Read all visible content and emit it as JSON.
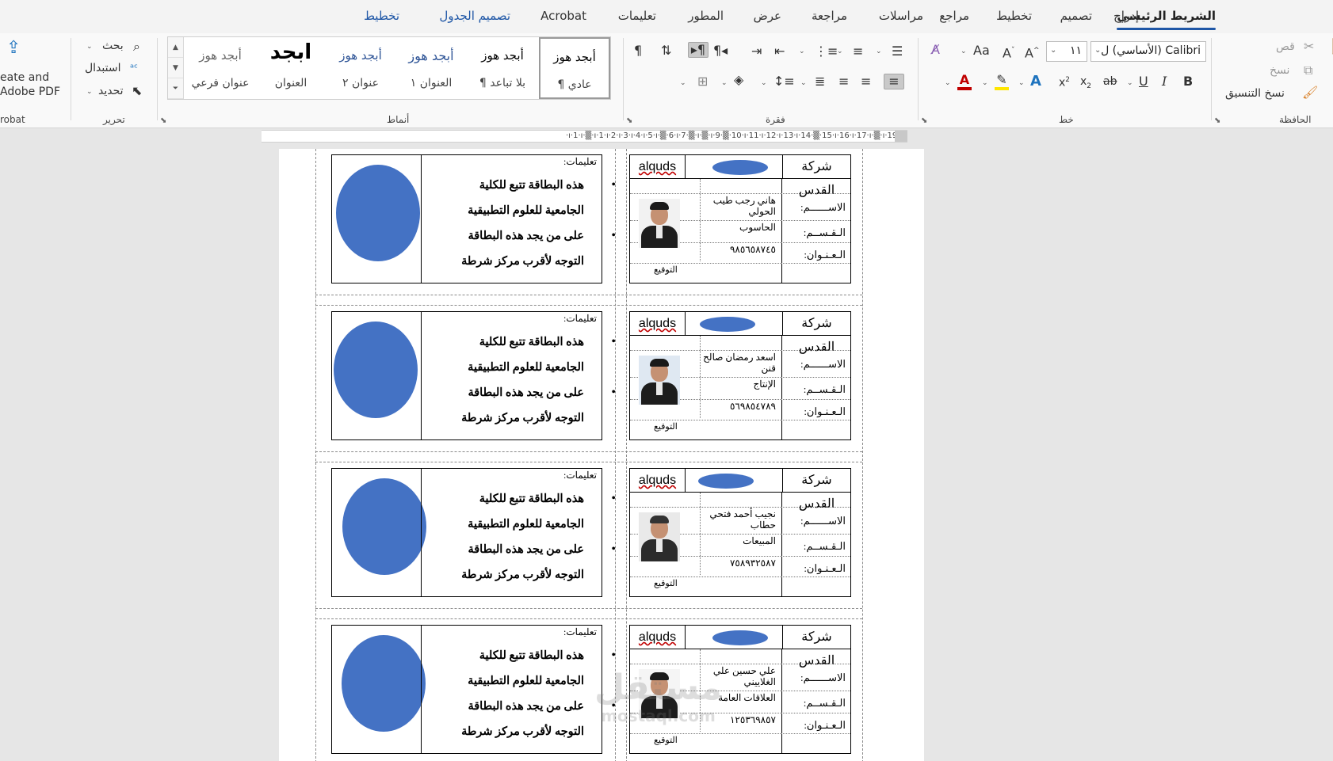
{
  "tabs": [
    {
      "label": "الشريط الرئيسي",
      "active": true
    },
    {
      "label": "إدراج"
    },
    {
      "label": "تصميم"
    },
    {
      "label": "تخطيط"
    },
    {
      "label": "مراجع"
    },
    {
      "label": "مراسلات"
    },
    {
      "label": "مراجعة"
    },
    {
      "label": "عرض"
    },
    {
      "label": "المطور"
    },
    {
      "label": "تعليمات"
    },
    {
      "label": "Acrobat"
    },
    {
      "label": "تصميم الجدول",
      "contextual": true
    },
    {
      "label": "تخطيط",
      "contextual": true
    }
  ],
  "ribbon": {
    "clipboard": {
      "cut": "قص",
      "copy": "نسخ",
      "format_painter": "نسخ التنسيق",
      "label": "الحافظة"
    },
    "font": {
      "name": "Calibri (الأساسي) ل",
      "size": "١١",
      "label": "خط"
    },
    "paragraph": {
      "label": "فقرة"
    },
    "styles": {
      "label": "أنماط",
      "items": [
        {
          "sample": "أبجد هوز",
          "name": "¶ عادي",
          "selected": true
        },
        {
          "sample": "أبجد هوز",
          "name": "¶ بلا تباعد"
        },
        {
          "sample": "أبجد هوز",
          "name": "العنوان ١"
        },
        {
          "sample": "أبجد هوز",
          "name": "عنوان ٢"
        },
        {
          "sample": "ابجد",
          "name": "العنوان"
        },
        {
          "sample": "أبجد هوز",
          "name": "عنوان فرعي"
        }
      ]
    },
    "editing": {
      "find": "بحث",
      "replace": "استبدال",
      "select": "تحديد",
      "label": "تحرير"
    },
    "acrobat": {
      "create_line1": "eate and",
      "create_line2": "Adobe PDF",
      "label": "robat"
    }
  },
  "ruler": {
    "text": "·2·ı·1·ı·▒·ı·1·ı·2·ı·3·ı·4·ı·5·ı·▒·6·ı·7·▒·ı·▒·ı·9·▒·10·ı·11·ı·12·ı·13·ı·14·▒·15·ı·16·ı·17·ı·▒·ı·19·"
  },
  "document": {
    "cards": [
      {
        "company": "شركة القدس",
        "logo_text": "alquds",
        "name_label": "الاســــــم:",
        "dept_label": "الـقـســم:",
        "addr_label": "الـعـنـوان:",
        "name": "هاني رجب طيب الحولي",
        "dept": "الحاسوب",
        "phone": "٩٨٥٦٥٨٧٤٥",
        "sign": "التوقيع"
      },
      {
        "company": "شركة القدس",
        "logo_text": "alquds",
        "name_label": "الاســــــم:",
        "dept_label": "الـقـســم:",
        "addr_label": "الـعـنـوان:",
        "name": "اسعد رمضان صالح قنن",
        "dept": "الإنتاج",
        "phone": "٥٦٩٨٥٤٧٨٩",
        "sign": "التوقيع"
      },
      {
        "company": "شركة القدس",
        "logo_text": "alquds",
        "name_label": "الاســــــم:",
        "dept_label": "الـقـســم:",
        "addr_label": "الـعـنـوان:",
        "name": "نجيب أحمد فتحي حطاب",
        "dept": "المبيعات",
        "phone": "٧٥٨٩٣٢٥٨٧",
        "sign": "التوقيع"
      },
      {
        "company": "شركة القدس",
        "logo_text": "alquds",
        "name_label": "الاســــــم:",
        "dept_label": "الـقـســم:",
        "addr_label": "الـعـنـوان:",
        "name": "علي حسين علي الغلاييني",
        "dept": "العلاقات العامة",
        "phone": "١٢٥٣٦٩٨٥٧",
        "sign": "التوقيع"
      }
    ],
    "back": {
      "title": "تعليمات:",
      "line1": "هذه البطاقة تتبع للكلية",
      "line2": "الجامعية للعلوم التطبيقية",
      "line3": "على من يجد هذه البطاقة",
      "line4": "التوجه لأقرب مركز شرطة"
    }
  },
  "watermark": {
    "arabic": "مستقل",
    "latin": "mostaql.com"
  },
  "colors": {
    "accent": "#1e56a6",
    "shape_fill": "#4472c4",
    "spell_underline": "#c00000"
  }
}
